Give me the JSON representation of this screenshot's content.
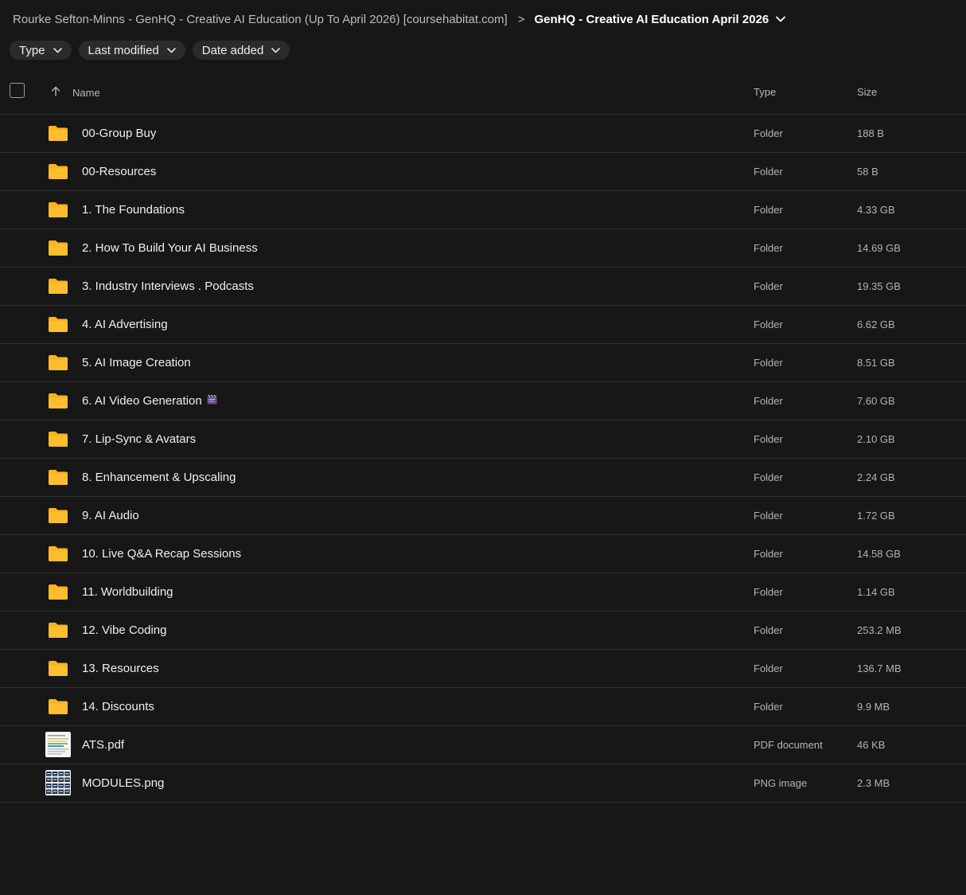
{
  "breadcrumb": {
    "parent": "Rourke Sefton-Minns - GenHQ - Creative AI Education (Up To April 2026) [coursehabitat.com]",
    "separator": ">",
    "current": "GenHQ - Creative AI Education April 2026"
  },
  "filters": {
    "type_label": "Type",
    "modified_label": "Last modified",
    "added_label": "Date added"
  },
  "columns": {
    "name": "Name",
    "type": "Type",
    "size": "Size"
  },
  "colors": {
    "folder": "#ffb31a",
    "background": "#171717"
  },
  "files": [
    {
      "name": "00-Group Buy",
      "type": "Folder",
      "size": "188 B",
      "icon": "folder-icon"
    },
    {
      "name": "00-Resources",
      "type": "Folder",
      "size": "58 B",
      "icon": "folder-icon"
    },
    {
      "name": "1. The Foundations",
      "type": "Folder",
      "size": "4.33 GB",
      "icon": "folder-icon"
    },
    {
      "name": "2. How To Build Your AI Business",
      "type": "Folder",
      "size": "14.69 GB",
      "icon": "folder-icon"
    },
    {
      "name": "3. Industry Interviews . Podcasts",
      "type": "Folder",
      "size": "19.35 GB",
      "icon": "folder-icon"
    },
    {
      "name": "4. AI Advertising",
      "type": "Folder",
      "size": "6.62 GB",
      "icon": "folder-icon"
    },
    {
      "name": "5. AI Image Creation",
      "type": "Folder",
      "size": "8.51 GB",
      "icon": "folder-icon"
    },
    {
      "name": "6. AI Video Generation",
      "type": "Folder",
      "size": "7.60 GB",
      "icon": "folder-icon",
      "emoji": "clapper-board-icon"
    },
    {
      "name": "7. Lip-Sync & Avatars",
      "type": "Folder",
      "size": "2.10 GB",
      "icon": "folder-icon"
    },
    {
      "name": "8. Enhancement & Upscaling",
      "type": "Folder",
      "size": "2.24 GB",
      "icon": "folder-icon"
    },
    {
      "name": "9. AI Audio",
      "type": "Folder",
      "size": "1.72 GB",
      "icon": "folder-icon"
    },
    {
      "name": "10. Live Q&A Recap Sessions",
      "type": "Folder",
      "size": "14.58 GB",
      "icon": "folder-icon"
    },
    {
      "name": "11. Worldbuilding",
      "type": "Folder",
      "size": "1.14 GB",
      "icon": "folder-icon"
    },
    {
      "name": "12. Vibe Coding",
      "type": "Folder",
      "size": "253.2 MB",
      "icon": "folder-icon"
    },
    {
      "name": "13. Resources",
      "type": "Folder",
      "size": "136.7 MB",
      "icon": "folder-icon"
    },
    {
      "name": "14. Discounts",
      "type": "Folder",
      "size": "9.9 MB",
      "icon": "folder-icon"
    },
    {
      "name": "ATS.pdf",
      "type": "PDF document",
      "size": "46 KB",
      "icon": "pdf-thumbnail"
    },
    {
      "name": "MODULES.png",
      "type": "PNG image",
      "size": "2.3 MB",
      "icon": "png-thumbnail"
    }
  ]
}
